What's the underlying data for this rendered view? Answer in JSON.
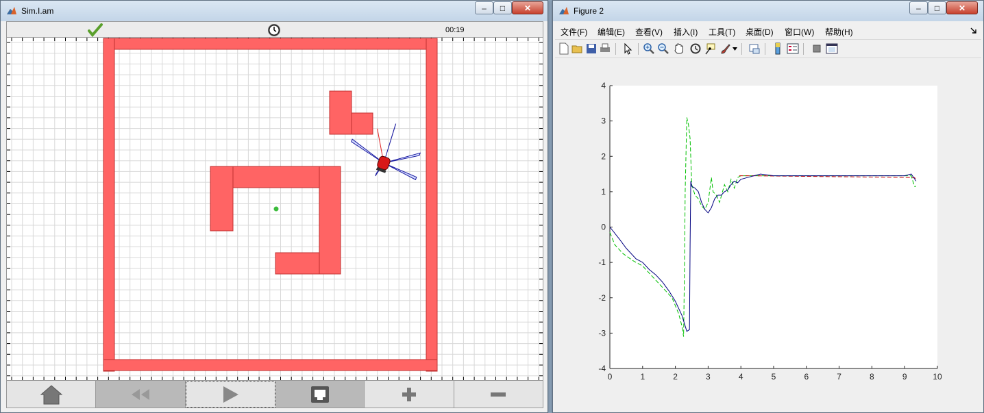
{
  "sim": {
    "title": "Sim.I.am",
    "clock": "00:19",
    "status": "ok"
  },
  "figure": {
    "title": "Figure 2",
    "menu": [
      "文件(F)",
      "编辑(E)",
      "查看(V)",
      "插入(I)",
      "工具(T)",
      "桌面(D)",
      "窗口(W)",
      "帮助(H)"
    ],
    "toolbar": [
      "new-figure",
      "open-file",
      "save",
      "print",
      "edit-plot",
      "zoom-in",
      "zoom-out",
      "pan",
      "rotate-3d",
      "data-cursor",
      "brush",
      "link-plot",
      "insert-colorbar",
      "insert-legend",
      "hide-plot-tools",
      "show-plot-tools"
    ]
  },
  "window_controls": {
    "minimize": "–",
    "maximize": "□",
    "close": "✕"
  },
  "chart_data": {
    "type": "line",
    "xlim": [
      0,
      10
    ],
    "ylim": [
      -4,
      4
    ],
    "xticks": [
      0,
      1,
      2,
      3,
      4,
      5,
      6,
      7,
      8,
      9,
      10
    ],
    "yticks": [
      -4,
      -3,
      -2,
      -1,
      0,
      1,
      2,
      3,
      4
    ],
    "grid": false,
    "series": [
      {
        "style": "dashed",
        "color": "#00bf00",
        "x": [
          0,
          0.15,
          0.4,
          0.7,
          1.0,
          1.3,
          1.6,
          1.9,
          2.1,
          2.2,
          2.25,
          2.28,
          2.3,
          2.35,
          2.4,
          2.45,
          2.5,
          2.6,
          2.7,
          2.8,
          2.9,
          3.0,
          3.1,
          3.15,
          3.25,
          3.35,
          3.5,
          3.6,
          3.7,
          3.8,
          3.9,
          4.0,
          4.2,
          4.4,
          4.6,
          5.0,
          6.0,
          7.0,
          8.0,
          8.5,
          9.0,
          9.2,
          9.3,
          9.35
        ],
        "y": [
          -0.15,
          -0.5,
          -0.75,
          -0.95,
          -1.1,
          -1.4,
          -1.7,
          -2.0,
          -2.45,
          -2.8,
          -3.1,
          -1.0,
          1.0,
          3.1,
          2.9,
          2.5,
          1.2,
          0.9,
          0.8,
          0.6,
          0.5,
          0.7,
          1.4,
          1.0,
          0.9,
          0.7,
          1.2,
          1.0,
          1.35,
          1.1,
          1.4,
          1.45,
          1.45,
          1.45,
          1.45,
          1.45,
          1.45,
          1.45,
          1.45,
          1.45,
          1.45,
          1.45,
          1.15,
          1.15
        ]
      },
      {
        "style": "dashed",
        "color": "#cc0000",
        "x": [
          3.95,
          4.3,
          9.3,
          9.35
        ],
        "y": [
          1.45,
          1.45,
          1.4,
          1.35
        ]
      },
      {
        "style": "solid",
        "color": "#000080",
        "x": [
          0,
          0.3,
          0.5,
          0.8,
          1.0,
          1.2,
          1.4,
          1.6,
          1.8,
          2.0,
          2.2,
          2.35,
          2.43,
          2.45,
          2.47,
          2.5,
          2.6,
          2.7,
          2.8,
          2.9,
          3.0,
          3.1,
          3.2,
          3.3,
          3.4,
          3.5,
          3.6,
          3.7,
          3.8,
          3.9,
          4.0,
          4.2,
          4.4,
          4.6,
          5.0,
          6.0,
          7.0,
          8.0,
          9.0,
          9.2,
          9.35
        ],
        "y": [
          0,
          -0.35,
          -0.6,
          -0.9,
          -1.0,
          -1.2,
          -1.35,
          -1.55,
          -1.8,
          -2.1,
          -2.5,
          -2.95,
          -2.9,
          -0.5,
          1.3,
          1.15,
          1.1,
          1.0,
          0.7,
          0.5,
          0.4,
          0.55,
          0.8,
          0.9,
          0.9,
          1.0,
          1.05,
          1.2,
          1.3,
          1.25,
          1.35,
          1.4,
          1.45,
          1.5,
          1.45,
          1.45,
          1.45,
          1.45,
          1.45,
          1.5,
          1.3
        ]
      }
    ]
  }
}
